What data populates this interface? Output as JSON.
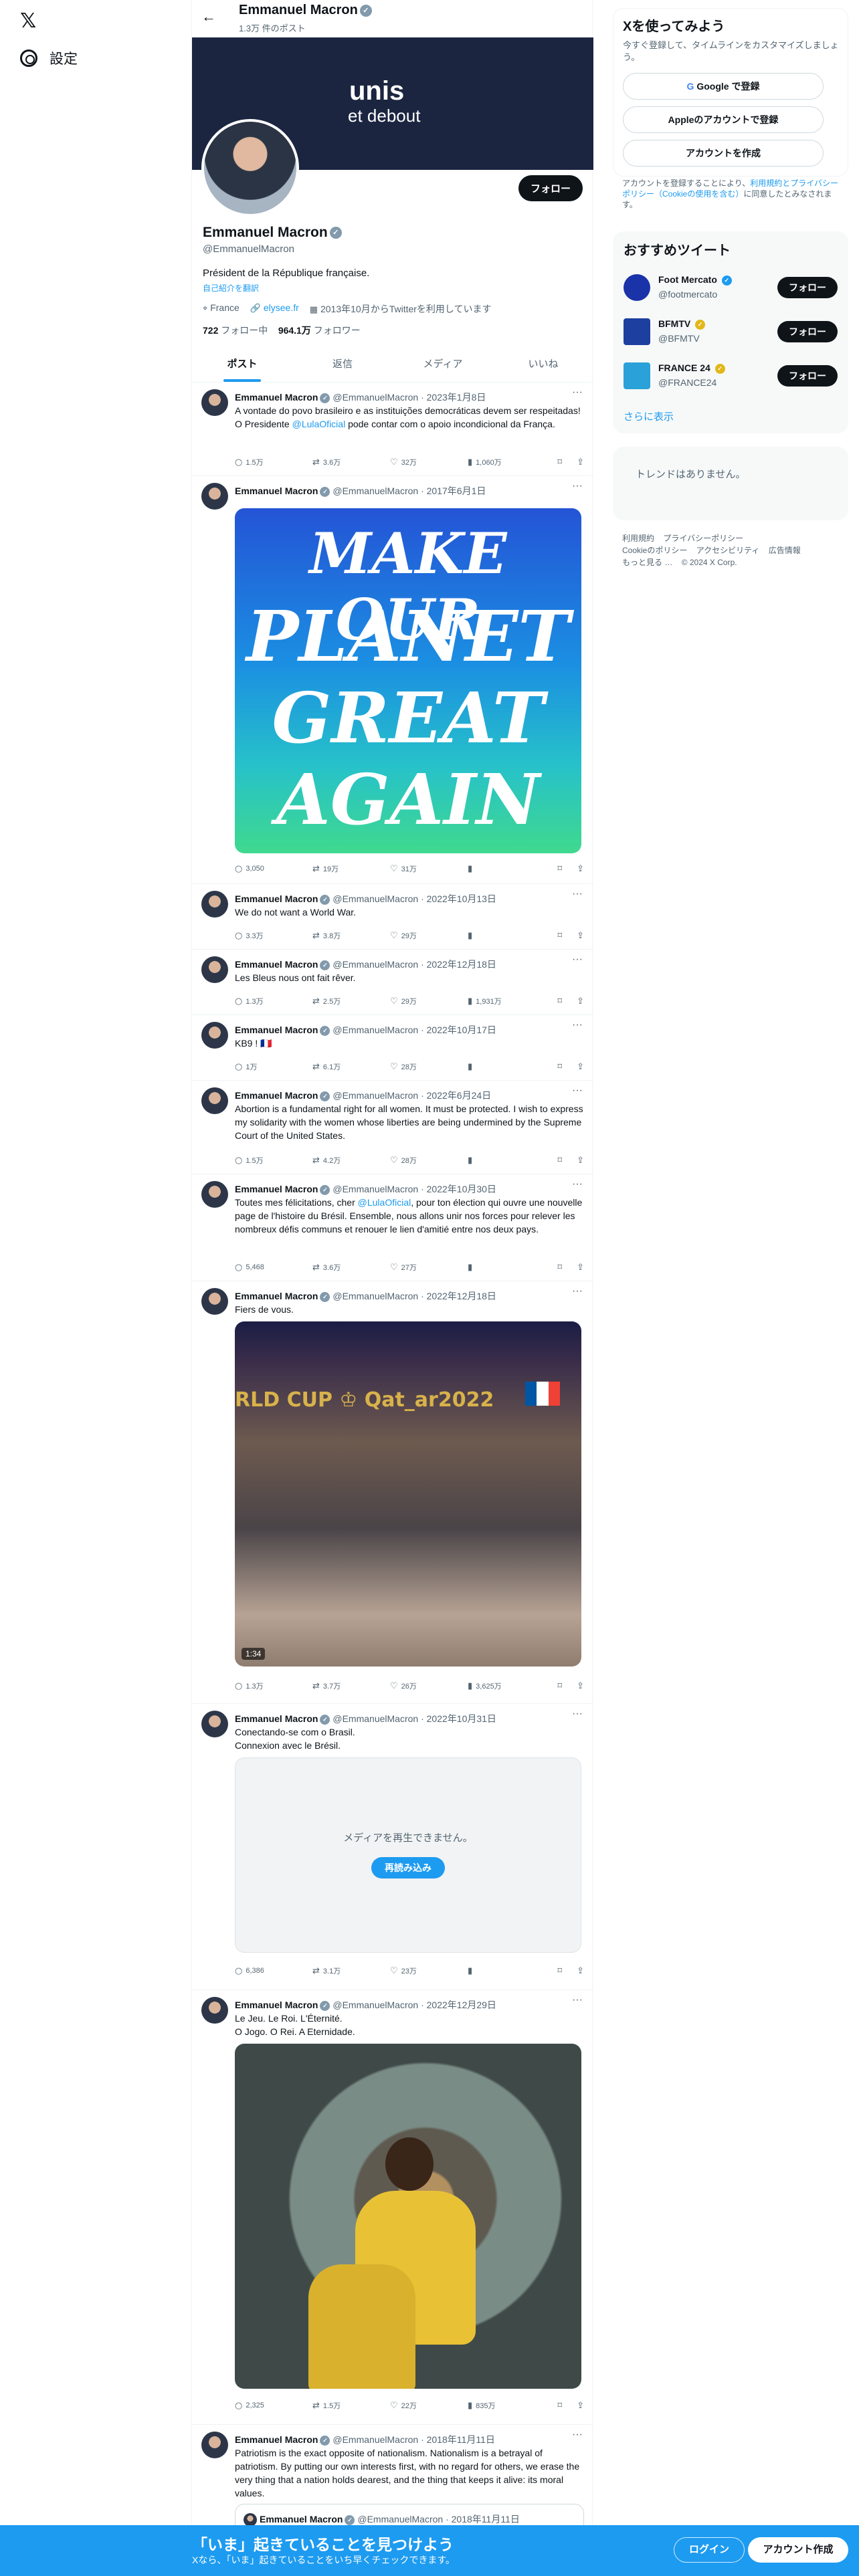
{
  "nav": {
    "settings_label": "設定"
  },
  "header": {
    "name": "Emmanuel Macron",
    "post_count": "1.3万 件のポスト"
  },
  "banner": {
    "line1": "unis",
    "line2": "et debout"
  },
  "profile": {
    "name": "Emmanuel Macron",
    "handle": "@EmmanuelMacron",
    "follow_label": "フォロー",
    "bio": "Président de la République française.",
    "translate": "自己紹介を翻訳",
    "location": "France",
    "website": "elysee.fr",
    "joined": "2013年10月からTwitterを利用しています",
    "following_count": "722",
    "following_label": "フォロー中",
    "followers_count": "964.1万",
    "followers_label": "フォロワー"
  },
  "tabs": [
    "ポスト",
    "返信",
    "メディア",
    "いいね"
  ],
  "tweets": [
    {
      "name": "Emmanuel Macron",
      "handle": "@EmmanuelMacron",
      "date": "2023年1月8日",
      "text_a": "A vontade do povo brasileiro e as instituições democráticas devem ser respeitadas! O Presidente ",
      "mention": "@LulaOficial",
      "text_b": " pode contar com o apoio incondicional da França.",
      "replies": "1.5万",
      "retweets": "3.6万",
      "likes": "32万",
      "views": "1,060万"
    },
    {
      "name": "Emmanuel Macron",
      "handle": "@EmmanuelMacron",
      "date": "2017年6月1日",
      "media_lines": [
        "MAKE OUR",
        "PLANET",
        "GREAT",
        "AGAIN"
      ],
      "replies": "3,050",
      "retweets": "19万",
      "likes": "31万"
    },
    {
      "name": "Emmanuel Macron",
      "handle": "@EmmanuelMacron",
      "date": "2022年10月13日",
      "text": "We do not want a World War.",
      "replies": "3.3万",
      "retweets": "3.8万",
      "likes": "29万"
    },
    {
      "name": "Emmanuel Macron",
      "handle": "@EmmanuelMacron",
      "date": "2022年12月18日",
      "text": "Les Bleus nous ont fait rêver.",
      "replies": "1.3万",
      "retweets": "2.5万",
      "likes": "29万",
      "views": "1,931万"
    },
    {
      "name": "Emmanuel Macron",
      "handle": "@EmmanuelMacron",
      "date": "2022年10月17日",
      "text": "KB9 ! 🇫🇷",
      "replies": "1万",
      "retweets": "6.1万",
      "likes": "28万"
    },
    {
      "name": "Emmanuel Macron",
      "handle": "@EmmanuelMacron",
      "date": "2022年6月24日",
      "text": "Abortion is a fundamental right for all women. It must be protected. I wish to express my solidarity with the women whose liberties are being undermined by the Supreme Court of the United States.",
      "replies": "1.5万",
      "retweets": "4.2万",
      "likes": "28万"
    },
    {
      "name": "Emmanuel Macron",
      "handle": "@EmmanuelMacron",
      "date": "2022年10月30日",
      "text_a": "Toutes mes félicitations, cher ",
      "mention": "@LulaOficial",
      "text_b": ", pour ton élection qui ouvre une nouvelle page de l'histoire du Brésil. Ensemble, nous allons unir nos forces pour relever les nombreux défis communs et renouer le lien d'amitié entre nos deux pays.",
      "replies": "5,468",
      "retweets": "3.6万",
      "likes": "27万"
    },
    {
      "name": "Emmanuel Macron",
      "handle": "@EmmanuelMacron",
      "date": "2022年12月18日",
      "text": "Fiers de vous.",
      "media_text": "RLD CUP ♔ Qat_ar2022",
      "video_time": "1:34",
      "replies": "1.3万",
      "retweets": "3.7万",
      "likes": "26万",
      "views": "3,625万"
    },
    {
      "name": "Emmanuel Macron",
      "handle": "@EmmanuelMacron",
      "date": "2022年10月31日",
      "text_l1": "Conectando-se com o Brasil.",
      "text_l2": "Connexion avec le Brésil.",
      "media_error": "メディアを再生できません。",
      "reload": "再読み込み",
      "replies": "6,386",
      "retweets": "3.1万",
      "likes": "23万"
    },
    {
      "name": "Emmanuel Macron",
      "handle": "@EmmanuelMacron",
      "date": "2022年12月29日",
      "text_l1": "Le Jeu. Le Roi. L'Éternité.",
      "text_l2": "O Jogo. O Rei. A Eternidade.",
      "replies": "2,325",
      "retweets": "1.5万",
      "likes": "22万",
      "views": "835万"
    },
    {
      "name": "Emmanuel Macron",
      "handle": "@EmmanuelMacron",
      "date": "2018年11月11日",
      "text": "Patriotism is the exact opposite of nationalism. Nationalism is a betrayal of patriotism. By putting our own interests first, with no regard for others, we erase the very thing that a nation holds dearest, and the thing that keeps it alive: its moral values.",
      "quote_name": "Emmanuel Macron",
      "quote_handle": "@EmmanuelMacron",
      "quote_date": "2018年11月11日"
    }
  ],
  "signup": {
    "title": "Xを使ってみよう",
    "subtitle": "今すぐ登録して、タイムラインをカスタマイズしましょう。",
    "google_label": "Google で登録",
    "apple_label": "Appleのアカウントで登録",
    "create_label": "アカウントを作成",
    "legal_a": "アカウントを登録することにより、",
    "legal_link": "利用規約とプライバシーポリシー（Cookieの使用を含む）",
    "legal_b": "に同意したとみなされます。"
  },
  "recommend": {
    "title": "おすすめツイート",
    "items": [
      {
        "name": "Foot Mercato",
        "handle": "@footmercato",
        "follow": "フォロー",
        "color": "#1a33a8"
      },
      {
        "name": "BFMTV",
        "handle": "@BFMTV",
        "follow": "フォロー",
        "color": "#1d3fa0"
      },
      {
        "name": "FRANCE 24",
        "handle": "@FRANCE24",
        "follow": "フォロー",
        "color": "#2aa1d8"
      }
    ],
    "more": "さらに表示"
  },
  "trends": {
    "empty": "トレンドはありません。"
  },
  "footer": {
    "links": [
      "利用規約",
      "プライバシーポリシー",
      "Cookieのポリシー",
      "アクセシビリティ",
      "広告情報",
      "もっと見る …",
      "© 2024 X Corp."
    ]
  },
  "bottom": {
    "title": "「いま」起きていることを見つけよう",
    "subtitle": "Xなら、「いま」起きていることをいち早くチェックできます。",
    "login": "ログイン",
    "signup": "アカウント作成"
  }
}
